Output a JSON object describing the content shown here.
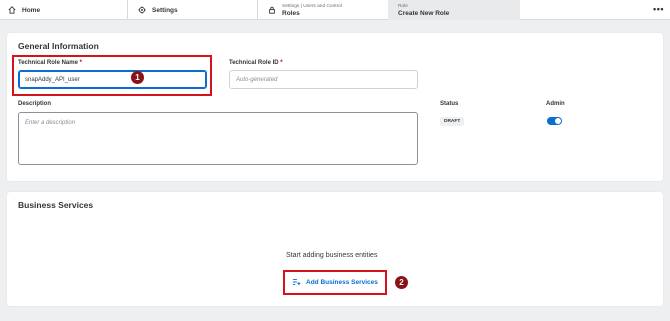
{
  "topbar": {
    "home_label": "Home",
    "settings_label": "Settings",
    "roles_path": "Settings | Users and Control",
    "roles_label": "Roles",
    "create_path": "Role",
    "create_label": "Create New Role",
    "more_label": "•••"
  },
  "general": {
    "title": "General Information",
    "technical_role_name_label": "Technical Role Name",
    "technical_role_name_value": "snapAddy_API_user",
    "technical_role_id_label": "Technical Role ID",
    "technical_role_id_placeholder": "Auto-generated",
    "description_label": "Description",
    "description_placeholder": "Enter a description",
    "status_label": "Status",
    "status_value": "DRAFT",
    "admin_label": "Admin",
    "admin_enabled": true,
    "required_marker": "*"
  },
  "business": {
    "title": "Business Services",
    "empty_text": "Start adding business entities",
    "add_button_label": "Add Business Services"
  },
  "callouts": {
    "one": "1",
    "two": "2"
  },
  "colors": {
    "accent": "#0a6ed1",
    "highlight": "#d3141d",
    "callout": "#8a1318"
  }
}
